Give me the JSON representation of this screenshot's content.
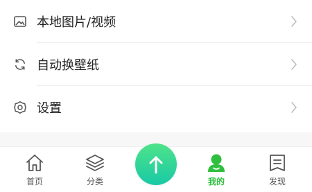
{
  "menu": {
    "items": [
      {
        "label": "本地图片/视频",
        "icon": "image-icon"
      },
      {
        "label": "自动换壁纸",
        "icon": "refresh-icon"
      },
      {
        "label": "设置",
        "icon": "gear-icon"
      }
    ]
  },
  "tabbar": {
    "tabs": [
      {
        "label": "首页",
        "icon": "home-icon"
      },
      {
        "label": "分类",
        "icon": "layers-icon"
      },
      {
        "label": "我的",
        "icon": "user-icon"
      },
      {
        "label": "发现",
        "icon": "bookmark-icon"
      }
    ],
    "center_icon": "upload-arrow-icon",
    "active_tab": "我的",
    "colors": {
      "active": "#2fbf3f",
      "inactive": "#555555",
      "center_top": "#4fe389",
      "center_bottom": "#18c9a6"
    }
  }
}
